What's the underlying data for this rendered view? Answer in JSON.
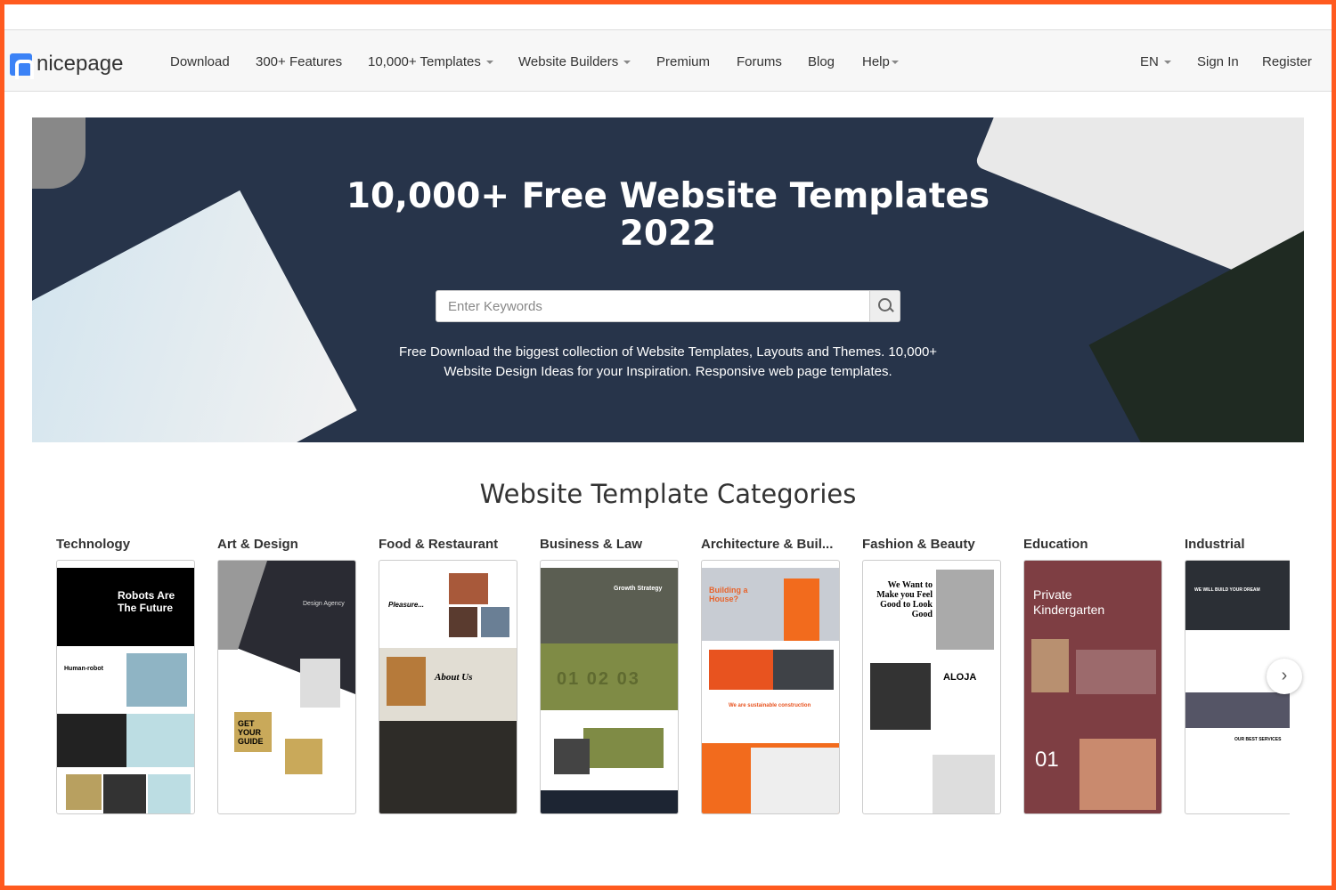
{
  "nav": {
    "logo": "nicepage",
    "items": [
      {
        "label": "Download",
        "dropdown": false
      },
      {
        "label": "300+ Features",
        "dropdown": false
      },
      {
        "label": "10,000+ Templates",
        "dropdown": true
      },
      {
        "label": "Website Builders",
        "dropdown": true
      },
      {
        "label": "Premium",
        "dropdown": false
      },
      {
        "label": "Forums",
        "dropdown": false
      },
      {
        "label": "Blog",
        "dropdown": false
      },
      {
        "label": "Help",
        "dropdown": true
      }
    ],
    "lang": "EN",
    "sign_in": "Sign In",
    "register": "Register"
  },
  "hero": {
    "title_line1": "10,000+ Free Website Templates",
    "title_line2": "2022",
    "search_placeholder": "Enter Keywords",
    "desc_line1": "Free Download the biggest collection of Website Templates, Layouts and Themes. 10,000+",
    "desc_line2": "Website Design Ideas for your Inspiration. Responsive web page templates."
  },
  "categories": {
    "title": "Website Template Categories",
    "items": [
      {
        "label": "Technology",
        "headline": "Robots Are The Future",
        "sub": "Human-robot"
      },
      {
        "label": "Art & Design",
        "headline": "Design Agency",
        "sub": "GET YOUR GUIDE"
      },
      {
        "label": "Food & Restaurant",
        "headline": "Pleasure...",
        "sub": "About Us"
      },
      {
        "label": "Business & Law",
        "headline": "Growth Strategy",
        "sub": "01 02 03"
      },
      {
        "label": "Architecture & Buil...",
        "headline": "Building a House?",
        "sub": "We are sustainable construction"
      },
      {
        "label": "Fashion & Beauty",
        "headline": "We Want to Make you Feel Good to Look Good",
        "sub": "ALOJA"
      },
      {
        "label": "Education",
        "headline": "Private Kindergarten",
        "sub": "01"
      },
      {
        "label": "Industrial",
        "headline": "WE WILL BUILD YOUR DREAM",
        "sub": "OUR BEST SERVICES"
      }
    ]
  },
  "colors": {
    "border": "#ff5a1f",
    "hero_bg": "#27344a",
    "logo": "#3b82f6"
  }
}
